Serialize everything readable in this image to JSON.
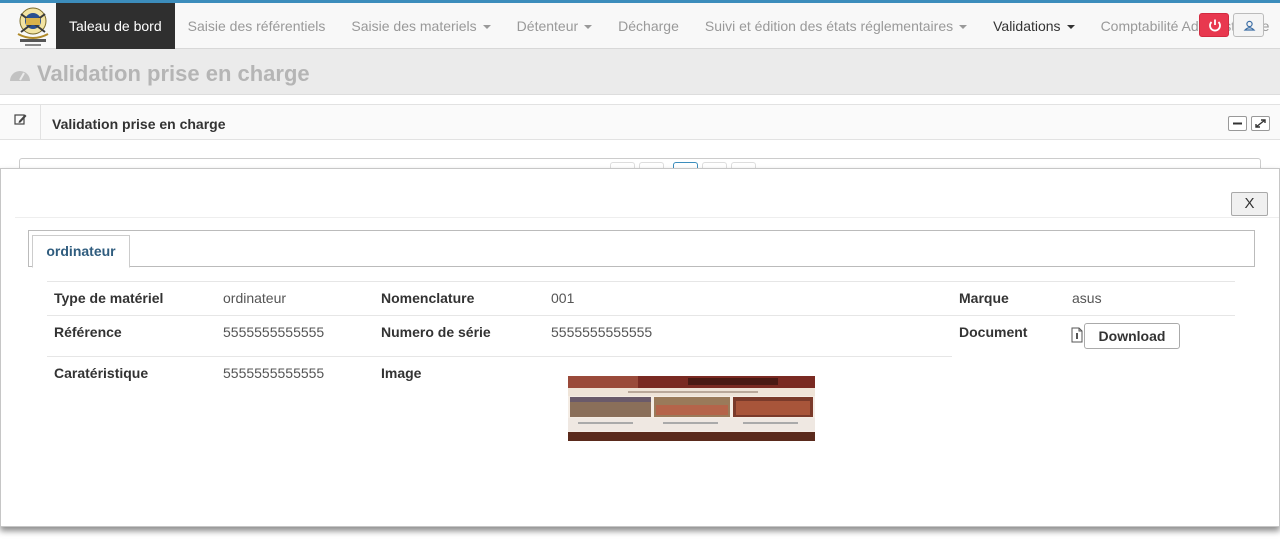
{
  "nav": {
    "items": [
      {
        "label": "Taleau de bord"
      },
      {
        "label": "Saisie des référentiels"
      },
      {
        "label": "Saisie des materiels"
      },
      {
        "label": "Détenteur"
      },
      {
        "label": "Décharge"
      },
      {
        "label": "Suivi et édition des états réglementaires"
      },
      {
        "label": "Validations"
      },
      {
        "label": "Comptabilité Administrative"
      }
    ],
    "icons": {
      "power": "power-icon",
      "user": "user-icon"
    },
    "colors": {
      "power_button": "#e8384f",
      "active_item": "#2f2f2f"
    }
  },
  "page": {
    "title": "Validation prise en charge"
  },
  "panel": {
    "title": "Validation prise en charge"
  },
  "modal": {
    "close_label": "X",
    "tab_label": "ordinateur",
    "fields": {
      "type_label": "Type de matériel",
      "type_value": "ordinateur",
      "nomenclature_label": "Nomenclature",
      "nomenclature_value": "001",
      "marque_label": "Marque",
      "marque_value": "asus",
      "reference_label": "Référence",
      "reference_value": "5555555555555",
      "serie_label": "Numero de série",
      "serie_value": "5555555555555",
      "document_label": "Document",
      "download_label": "Download",
      "caracteristique_label": "Caratéristique",
      "caracteristique_value": "5555555555555",
      "image_label": "Image"
    }
  }
}
